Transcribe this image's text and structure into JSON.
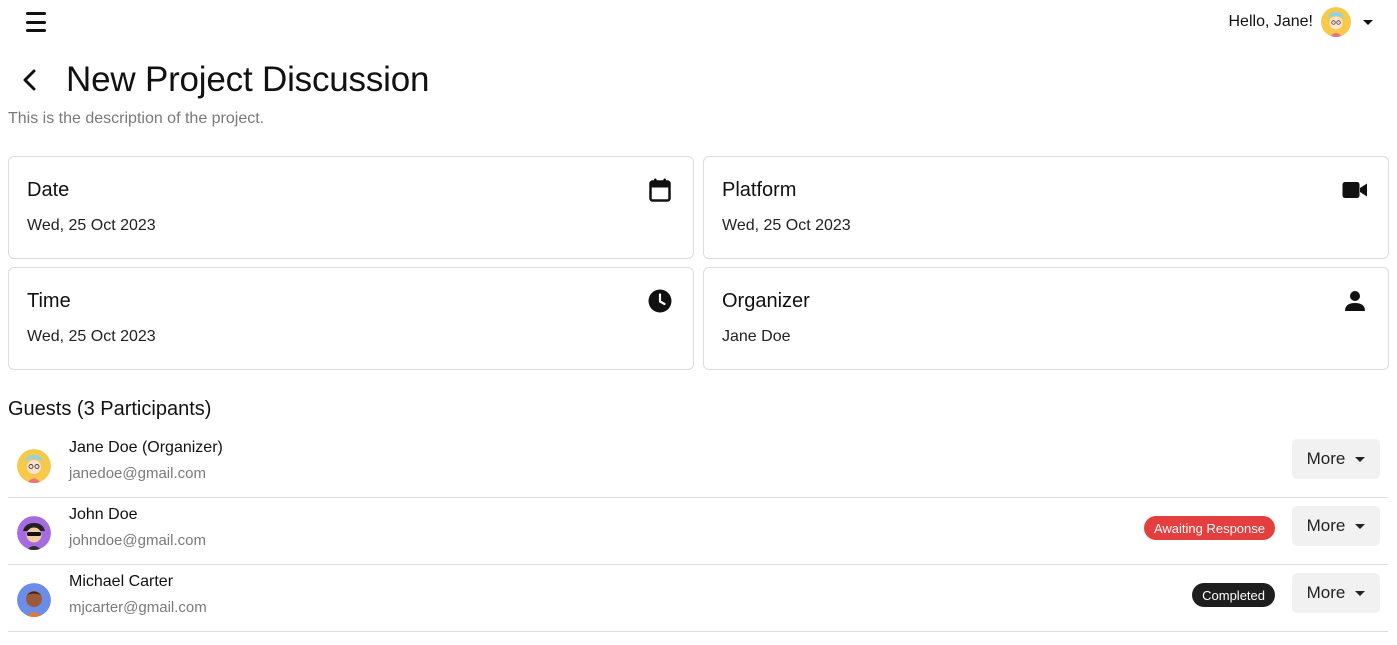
{
  "header": {
    "greeting": "Hello, Jane!",
    "avatar_icon": "user-avatar-icon",
    "menu_icon": "hamburger-menu-icon"
  },
  "page": {
    "title": "New Project Discussion",
    "description": "This is the description of the project."
  },
  "cards": {
    "date": {
      "label": "Date",
      "value": "Wed, 25 Oct 2023",
      "icon": "calendar-icon"
    },
    "platform": {
      "label": "Platform",
      "value": "Wed, 25 Oct 2023",
      "icon": "video-camera-icon"
    },
    "time": {
      "label": "Time",
      "value": "Wed, 25 Oct 2023",
      "icon": "clock-icon"
    },
    "organizer": {
      "label": "Organizer",
      "value": "Jane Doe",
      "icon": "person-icon"
    }
  },
  "guests": {
    "title": "Guests (3 Participants)",
    "items": [
      {
        "name": "Jane Doe (Organizer)",
        "email": "janedoe@gmail.com",
        "status": "",
        "more_label": "More"
      },
      {
        "name": "John Doe",
        "email": "johndoe@gmail.com",
        "status": "Awaiting Response",
        "more_label": "More"
      },
      {
        "name": "Michael Carter",
        "email": "mjcarter@gmail.com",
        "status": "Completed",
        "more_label": "More"
      }
    ]
  },
  "colors": {
    "awaiting": "#e53e3e",
    "completed": "#1e1e1e",
    "border": "#dcdcdc"
  }
}
